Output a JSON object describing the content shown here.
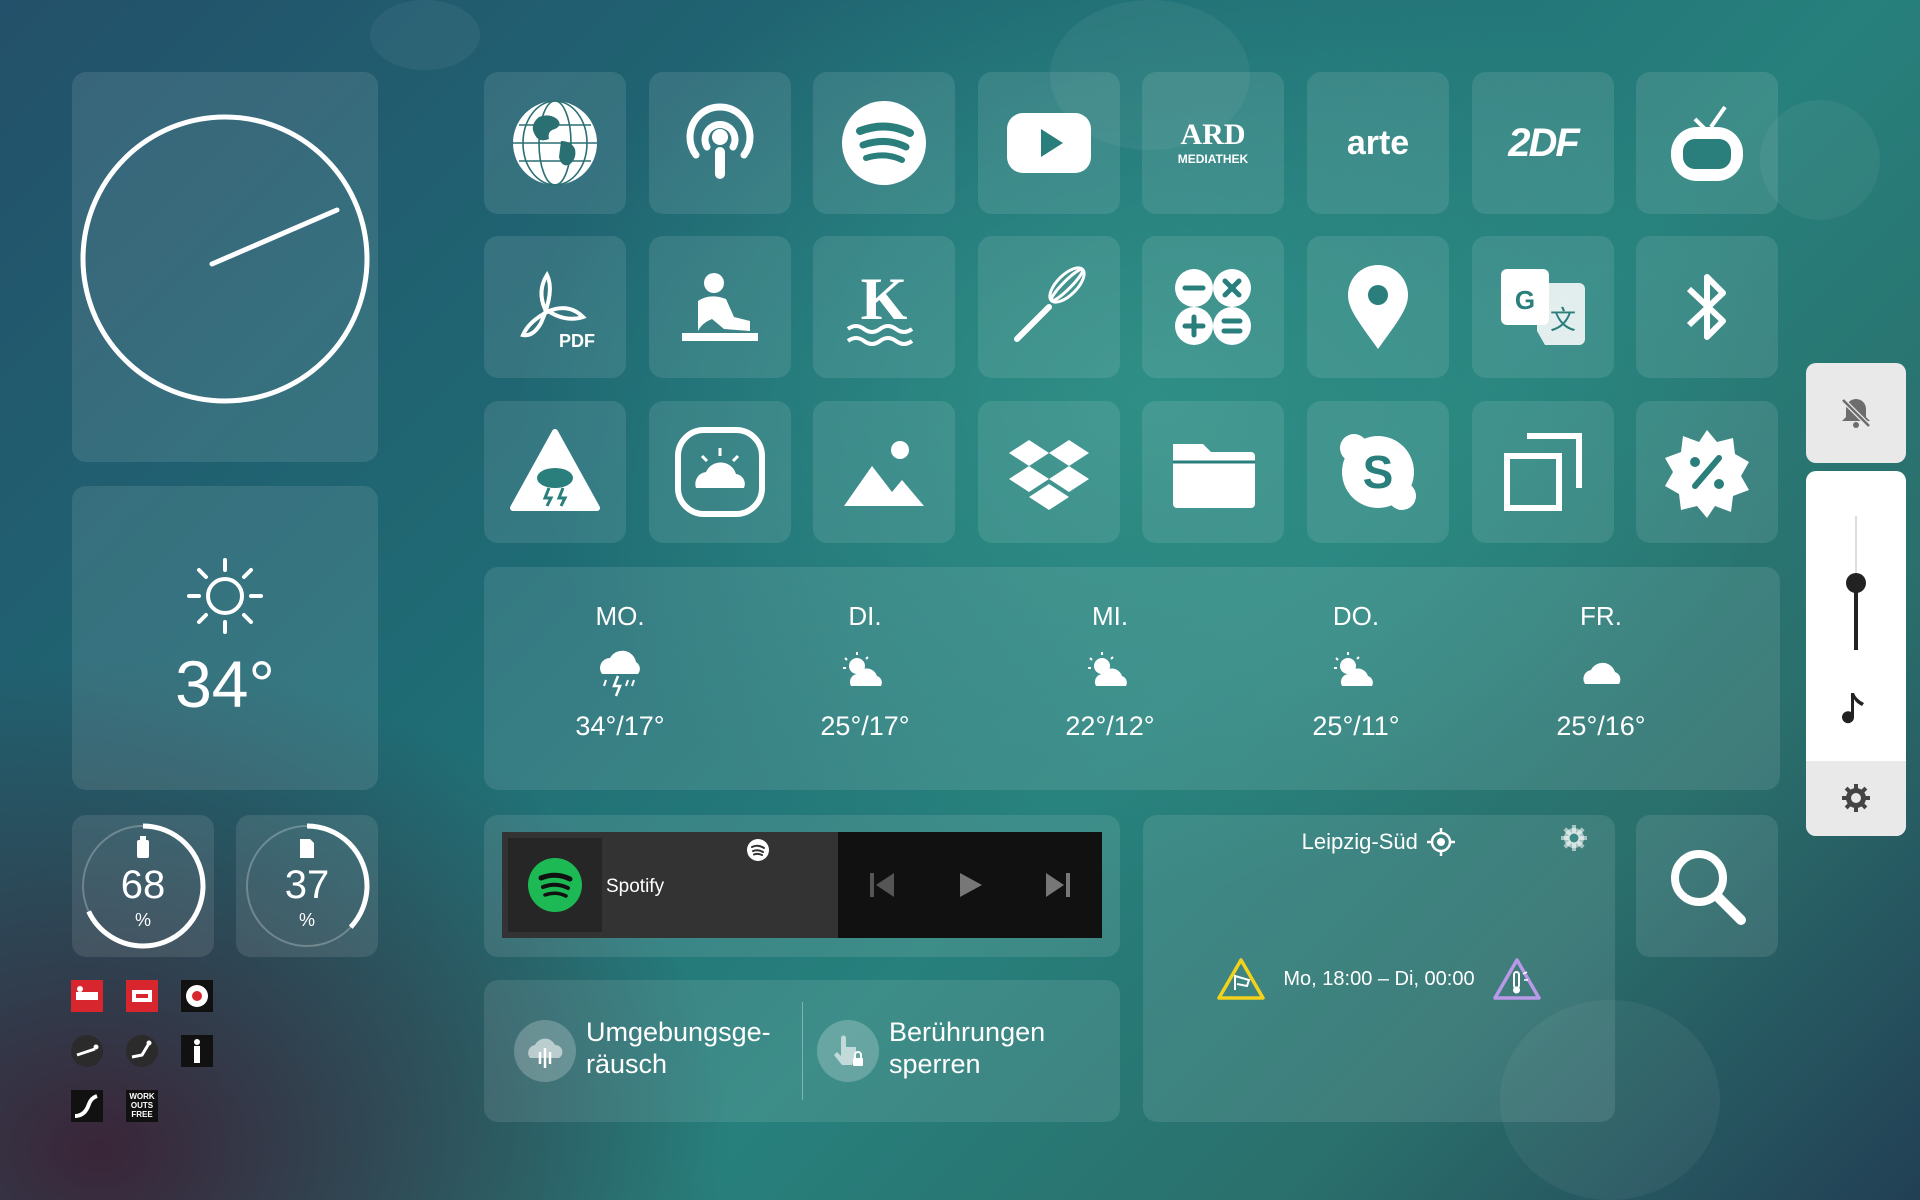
{
  "apps": {
    "row1": [
      {
        "name": "browser-globe"
      },
      {
        "name": "podcast"
      },
      {
        "name": "spotify"
      },
      {
        "name": "youtube"
      },
      {
        "name": "ard-mediathek",
        "logo_text": "ARD",
        "logo_sub": "MEDIATHEK"
      },
      {
        "name": "arte",
        "logo_text": "arte"
      },
      {
        "name": "zdf",
        "logo_text": "2DF"
      },
      {
        "name": "tv"
      }
    ],
    "row2": [
      {
        "name": "pdf-reader",
        "logo_text": "PDF"
      },
      {
        "name": "kindle"
      },
      {
        "name": "kachelmann",
        "logo_text": "K"
      },
      {
        "name": "whisk-recipes"
      },
      {
        "name": "calculator"
      },
      {
        "name": "maps"
      },
      {
        "name": "translate"
      },
      {
        "name": "bluetooth"
      }
    ],
    "row3": [
      {
        "name": "weather-warning"
      },
      {
        "name": "weather-app"
      },
      {
        "name": "gallery"
      },
      {
        "name": "dropbox"
      },
      {
        "name": "files"
      },
      {
        "name": "skype"
      },
      {
        "name": "multitask"
      },
      {
        "name": "deals"
      }
    ]
  },
  "current_weather": {
    "temp": "34°"
  },
  "forecast": [
    {
      "day": "MO.",
      "temps": "34°/17°",
      "icon": "thunderstorm-icon"
    },
    {
      "day": "DI.",
      "temps": "25°/17°",
      "icon": "partly-cloudy-icon"
    },
    {
      "day": "MI.",
      "temps": "22°/12°",
      "icon": "partly-cloudy-icon"
    },
    {
      "day": "DO.",
      "temps": "25°/11°",
      "icon": "partly-cloudy-icon"
    },
    {
      "day": "FR.",
      "temps": "25°/16°",
      "icon": "cloud-icon"
    }
  ],
  "battery": {
    "value": "68",
    "unit": "%",
    "fraction": 0.68
  },
  "storage": {
    "value": "37",
    "unit": "%",
    "fraction": 0.37
  },
  "media": {
    "app": "Spotify"
  },
  "quick": {
    "noise": "Umgebungsge-räusch",
    "noise_line1": "Umgebungsge-",
    "noise_line2": "räusch",
    "lock_line1": "Berührungen",
    "lock_line2": "sperren"
  },
  "location": {
    "name": "Leipzig-Süd",
    "warning": "Mo, 18:00 – Di, 00:00"
  },
  "volume": {
    "level": 0.5
  },
  "colors": {
    "spotify": "#1DB954",
    "warning_yellow": "#f2d21b",
    "warning_purple": "#b999e8",
    "workout_red": "#d8262e"
  },
  "mini_apps": [
    {
      "name": "workout-app-1"
    },
    {
      "name": "workout-app-2"
    },
    {
      "name": "workout-app-3"
    },
    {
      "name": "workout-app-4"
    },
    {
      "name": "workout-app-5"
    },
    {
      "name": "workout-app-6"
    },
    {
      "name": "workout-app-7"
    },
    {
      "name": "workouts-free",
      "text": "WORK OUTS FREE"
    }
  ]
}
